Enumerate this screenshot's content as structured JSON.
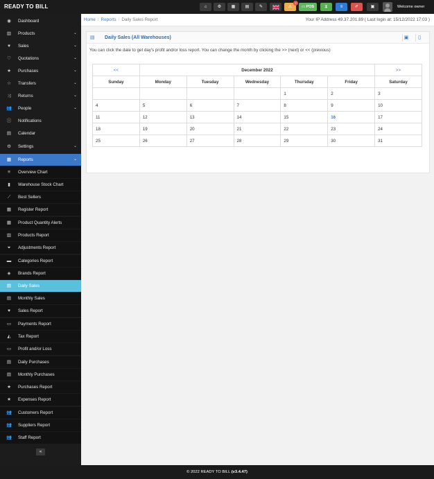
{
  "app": {
    "brand": "READY TO BILL"
  },
  "topbar": {
    "pos_label": "POS",
    "alert_count": "2",
    "welcome": "Welcome owner"
  },
  "sidebar": {
    "items": [
      {
        "label": "Dashboard",
        "icon": "dashboard-icon"
      },
      {
        "label": "Products",
        "icon": "barcode-icon"
      },
      {
        "label": "Sales",
        "icon": "heart-icon"
      },
      {
        "label": "Quotations",
        "icon": "heart-outline-icon"
      },
      {
        "label": "Purchases",
        "icon": "star-icon"
      },
      {
        "label": "Transfers",
        "icon": "star-outline-icon"
      },
      {
        "label": "Returns",
        "icon": "random-icon"
      },
      {
        "label": "People",
        "icon": "users-icon"
      },
      {
        "label": "Notifications",
        "icon": "info-icon"
      },
      {
        "label": "Calendar",
        "icon": "calendar-icon"
      },
      {
        "label": "Settings",
        "icon": "cog-icon"
      },
      {
        "label": "Reports",
        "icon": "bar-chart-icon"
      }
    ],
    "report_items": [
      {
        "label": "Overview Chart"
      },
      {
        "label": "Warehouse Stock Chart"
      },
      {
        "label": "Best Sellers"
      },
      {
        "label": "Register Report"
      },
      {
        "label": "Product Quantity Alerts"
      },
      {
        "label": "Products Report"
      },
      {
        "label": "Adjustments Report"
      },
      {
        "label": "Categories Report"
      },
      {
        "label": "Brands Report"
      },
      {
        "label": "Daily Sales"
      },
      {
        "label": "Monthly Sales"
      },
      {
        "label": "Sales Report"
      },
      {
        "label": "Payments Report"
      },
      {
        "label": "Tax Report"
      },
      {
        "label": "Profit and/or Loss"
      },
      {
        "label": "Daily Purchases"
      },
      {
        "label": "Monthly Purchases"
      },
      {
        "label": "Purchases Report"
      },
      {
        "label": "Expenses Report"
      },
      {
        "label": "Customers Report"
      },
      {
        "label": "Suppliers Report"
      },
      {
        "label": "Staff Report"
      }
    ],
    "collapse_label": "«"
  },
  "breadcrumb": {
    "home": "Home",
    "reports": "Reports",
    "current": "Daily Sales Report"
  },
  "ip_info": "Your IP Address 49.37.201.89 ( Last login at: 15/12/2022 17:03 )",
  "panel": {
    "title": "Daily Sales (All Warehouses)",
    "intro": "You can click the date to get day's profit and/or loss report. You can change the month by clicking the >> (next) or << (previous)"
  },
  "calendar": {
    "prev": "<<",
    "next": ">>",
    "month": "December 2022",
    "weekdays": [
      "Sunday",
      "Monday",
      "Tuesday",
      "Wednesday",
      "Thursday",
      "Friday",
      "Saturday"
    ],
    "weeks": [
      [
        "",
        "",
        "",
        "",
        "1",
        "2",
        "3"
      ],
      [
        "4",
        "5",
        "6",
        "7",
        "8",
        "9",
        "10"
      ],
      [
        "11",
        "12",
        "13",
        "14",
        "15",
        "16",
        "17"
      ],
      [
        "18",
        "19",
        "20",
        "21",
        "22",
        "23",
        "24"
      ],
      [
        "25",
        "26",
        "27",
        "28",
        "29",
        "30",
        "31"
      ]
    ],
    "today": "16"
  },
  "footer": {
    "copyright": "© 2022 READY TO BILL",
    "version": "(v3.4.47)"
  },
  "colors": {
    "accent": "#3b78c9",
    "active": "#5bc0de",
    "dark": "#1c1c1c"
  }
}
